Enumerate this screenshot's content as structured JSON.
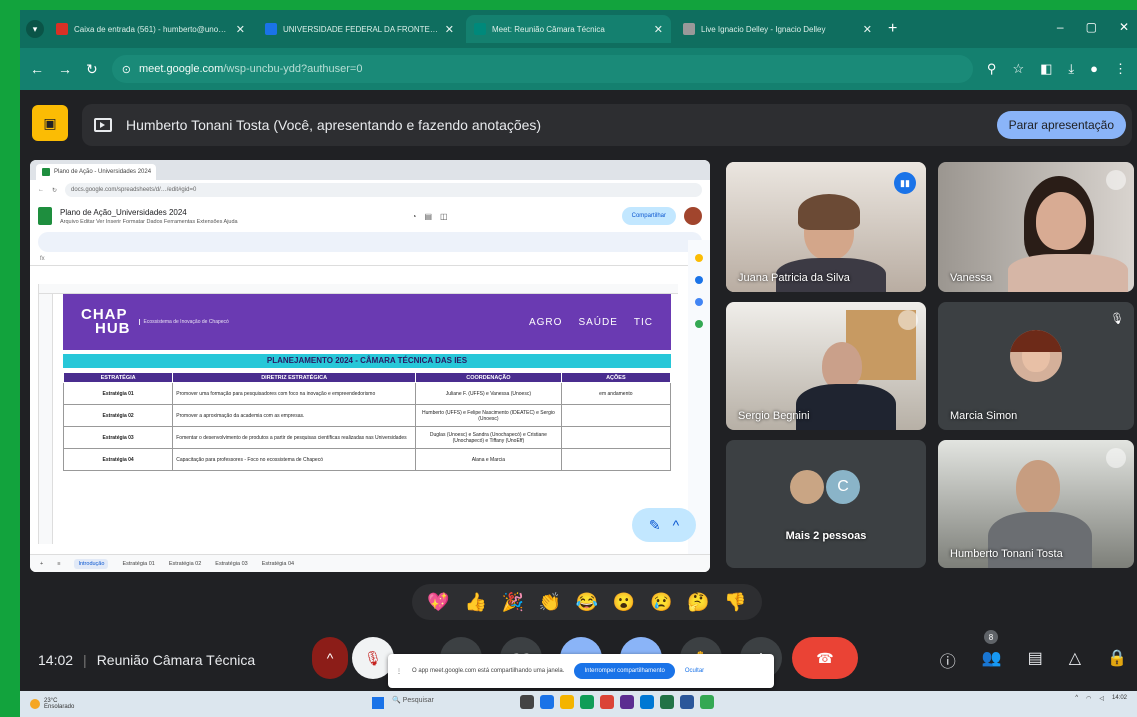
{
  "browser": {
    "tabs": [
      {
        "title": "Caixa de entrada (561) - humberto@unochapeco.edu.br",
        "fav_color": "#d93025",
        "active": false
      },
      {
        "title": "UNIVERSIDADE FEDERAL DA FRONTEIRA SUL - UFFS",
        "fav_color": "#1a73e8",
        "active": false
      },
      {
        "title": "Meet: Reunião Câmara Técnica",
        "fav_color": "#00897b",
        "active": true
      },
      {
        "title": "Live Ignacio Delley - Ignacio Delley",
        "fav_color": "#999999",
        "active": false
      }
    ],
    "url_host": "meet.google.com",
    "url_path": "/wsp-uncbu-ydd?authuser=0"
  },
  "meet": {
    "presenter_banner": "Humberto Tonani Tosta (Você, apresentando e fazendo anotações)",
    "stop_presenting_label": "Parar apresentação",
    "time": "14:02",
    "meeting_name": "Reunião Câmara Técnica",
    "people_badge": "8",
    "toast": {
      "text": "O app meet.google.com está compartilhando uma janela.",
      "primary": "Interromper compartilhamento",
      "secondary": "Ocultar"
    }
  },
  "participants": [
    {
      "name": "Juana Patricia da Silva"
    },
    {
      "name": "Vanessa"
    },
    {
      "name": "Sergio Begnini"
    },
    {
      "name": "Marcia Simon"
    },
    {
      "name": "Mais 2 pessoas",
      "initial": "C"
    },
    {
      "name": "Humberto Tonani Tosta"
    }
  ],
  "reactions": [
    "💖",
    "👍",
    "🎉",
    "👏",
    "😂",
    "😮",
    "😢",
    "🤔",
    "👎"
  ],
  "shared_sheet": {
    "tab_title": "Plano de Ação - Universidades 2024",
    "doc_title": "Plano de Ação_Universidades 2024",
    "menus": "Arquivo  Editar  Ver  Inserir  Formatar  Dados  Ferramentas  Extensões  Ajuda",
    "share_label": "Compartilhar",
    "brand_top": "CHAP",
    "brand_bottom": "HUB",
    "brand_sub": "Ecossistema de Inovação de Chapecó",
    "areas": [
      "AGRO",
      "SAÚDE",
      "TIC"
    ],
    "sheet_heading": "PLANEJAMENTO 2024 - CÂMARA TÉCNICA DAS IES",
    "columns": [
      "ESTRATÉGIA",
      "DIRETRIZ ESTRATÉGICA",
      "COORDENAÇÃO",
      "AÇÕES"
    ],
    "rows": [
      {
        "strategy": "Estratégia 01",
        "directive": "Promover uma formação para pesquisadores com foco na inovação e empreendedorismo",
        "coord": "Juliane F. (UFFS) e Vanessa (Unoesc)",
        "actions": "em andamento"
      },
      {
        "strategy": "Estratégia 02",
        "directive": "Promover a aproximação da academia com as empresas.",
        "coord": "Humberto (UFFS) e Felipe Nascimento (IDEATEC) e Sergio (Unoesc)",
        "actions": ""
      },
      {
        "strategy": "Estratégia 03",
        "directive": "Fomentar o desenvolvimento de produtos a partir de pesquisas científicas realizadas nas Universidades",
        "coord": "Duglas (Unoesc) e Sandra (Unochapecó) e Cristiane (Unochapecó) e Tiffany (UnoEff)",
        "actions": ""
      },
      {
        "strategy": "Estratégia 04",
        "directive": "Capacitação para professores - Foco no ecossistema de Chapecó",
        "coord": "Alana e Marcia",
        "actions": ""
      }
    ],
    "sheet_tabs": [
      "Introdução",
      "Estratégia 01",
      "Estratégia 02",
      "Estratégia 03",
      "Estratégia 04"
    ]
  },
  "taskbar": {
    "weather": "23°C",
    "weather_desc": "Ensolarado",
    "search": "Pesquisar",
    "clock": "14:02"
  }
}
